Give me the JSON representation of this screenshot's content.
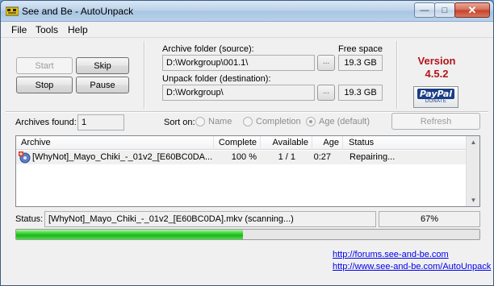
{
  "window": {
    "title": "See and Be - AutoUnpack"
  },
  "menu": {
    "file": "File",
    "tools": "Tools",
    "help": "Help"
  },
  "controls": {
    "start": "Start",
    "skip": "Skip",
    "stop": "Stop",
    "pause": "Pause"
  },
  "source": {
    "label": "Archive folder (source):",
    "path": "D:\\Workgroup\\001.1\\",
    "browse": "...",
    "free_space": "19.3 GB"
  },
  "destination": {
    "label": "Unpack folder (destination):",
    "path": "D:\\Workgroup\\",
    "browse": "...",
    "free_space": "19.3 GB"
  },
  "free_space_label": "Free space",
  "version": {
    "line1": "Version",
    "line2": "4.5.2"
  },
  "paypal": {
    "brand": "PayPal",
    "sub": "DONATE"
  },
  "archives_found": {
    "label": "Archives found:",
    "value": "1"
  },
  "sort": {
    "label": "Sort on:",
    "options": [
      "Name",
      "Completion",
      "Age (default)"
    ],
    "selected": "Age (default)"
  },
  "refresh": "Refresh",
  "table": {
    "columns": [
      "Archive",
      "Complete",
      "Available",
      "Age",
      "Status"
    ],
    "rows": [
      {
        "archive": "[WhyNot]_Mayo_Chiki_-_01v2_[E60BC0DA...",
        "complete": "100 %",
        "available": "1 / 1",
        "age": "0:27",
        "status": "Repairing..."
      }
    ]
  },
  "status": {
    "label": "Status:",
    "text": "[WhyNot]_Mayo_Chiki_-_01v2_[E60BC0DA].mkv (scanning...)",
    "percent": "67%"
  },
  "progress": {
    "fraction": 0.49
  },
  "links": {
    "forums": "http://forums.see-and-be.com",
    "autounpack": "http://www.see-and-be.com/AutoUnpack"
  },
  "colors": {
    "accent": "#b4141c",
    "progress": "#2cc82a",
    "link": "#0000ee"
  }
}
